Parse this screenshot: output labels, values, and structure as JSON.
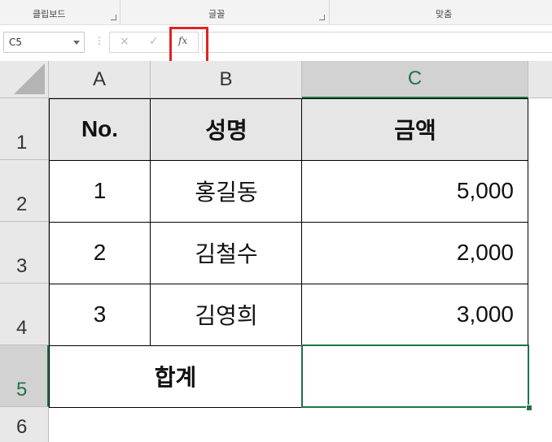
{
  "ribbon": {
    "groups": [
      {
        "label": "클립보드"
      },
      {
        "label": "글꼴"
      },
      {
        "label": "맞춤"
      }
    ]
  },
  "formula_bar": {
    "name_box": "C5",
    "cancel_icon": "×",
    "enter_icon": "✓",
    "fx_label": "fx",
    "formula": ""
  },
  "sheet": {
    "columns": [
      "A",
      "B",
      "C"
    ],
    "rows": [
      "1",
      "2",
      "3",
      "4",
      "5",
      "6"
    ],
    "selected_cell": "C5",
    "header": {
      "a": "No.",
      "b": "성명",
      "c": "금액"
    },
    "data": [
      {
        "no": "1",
        "name": "홍길동",
        "amount": "5,000"
      },
      {
        "no": "2",
        "name": "김철수",
        "amount": "2,000"
      },
      {
        "no": "3",
        "name": "김영희",
        "amount": "3,000"
      }
    ],
    "total_label": "합계",
    "total_value": ""
  },
  "colors": {
    "accent_green": "#217346",
    "highlight_red": "#e22222"
  }
}
